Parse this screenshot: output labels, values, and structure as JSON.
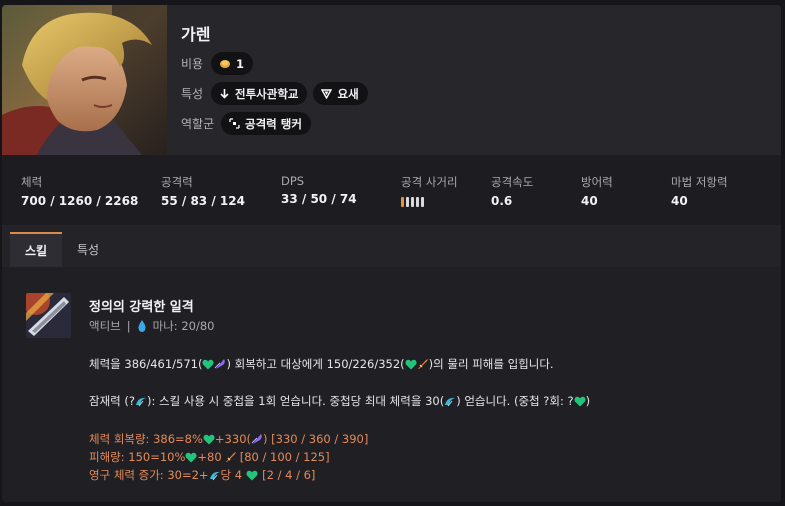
{
  "champion": {
    "name": "가렌",
    "cost_label": "비용",
    "cost": "1",
    "trait_label": "특성",
    "traits": [
      "전투사관학교",
      "요새"
    ],
    "role_label": "역할군",
    "role": "공격력 탱커"
  },
  "stats": {
    "hp": {
      "label": "체력",
      "value": "700 / 1260 / 2268"
    },
    "ad": {
      "label": "공격력",
      "value": "55 / 83 / 124"
    },
    "dps": {
      "label": "DPS",
      "value": "33 / 50 / 74"
    },
    "range": {
      "label": "공격 사거리",
      "filled": 1,
      "total": 5
    },
    "as": {
      "label": "공격속도",
      "value": "0.6"
    },
    "armor": {
      "label": "방어력",
      "value": "40"
    },
    "mr": {
      "label": "마법 저항력",
      "value": "40"
    }
  },
  "tabs": [
    "스킬",
    "특성"
  ],
  "skill": {
    "name": "정의의 강력한 일격",
    "type": "액티브",
    "separator": "|",
    "mana": "마나: 20/80",
    "line1_a": "체력을 386/461/571(",
    "line1_b": ") 회복하고 대상에게 150/226/352(",
    "line1_c": ")의 물리 피해를 입힙니다.",
    "line2_a": "잠재력 (?",
    "line2_b": "): 스킬 사용 시 중첩을 1회 얻습니다. 중첩당 최대 체력을 30(",
    "line2_c": ") 얻습니다. (중첩 ?회: ?",
    "line2_d": ")",
    "heal_a": "체력 회복량: 386=8%",
    "heal_b": "+330(",
    "heal_c": ") [330 / 360 / 390]",
    "dmg_a": "피해량: 150=10%",
    "dmg_b": "+80",
    "dmg_c": "[80 / 100 / 125]",
    "perm_a": "영구 체력 증가: 30=2+",
    "perm_b": "당 4",
    "perm_c": "[2 / 4 / 6]"
  },
  "colors": {
    "accent": "#d98a4a",
    "heal_green": "#22c47a",
    "ap_purple": "#8a6cf0",
    "ad_orange": "#e8803a",
    "potential_cyan": "#3fb8d8",
    "highlight_text": "#e58a5a"
  }
}
